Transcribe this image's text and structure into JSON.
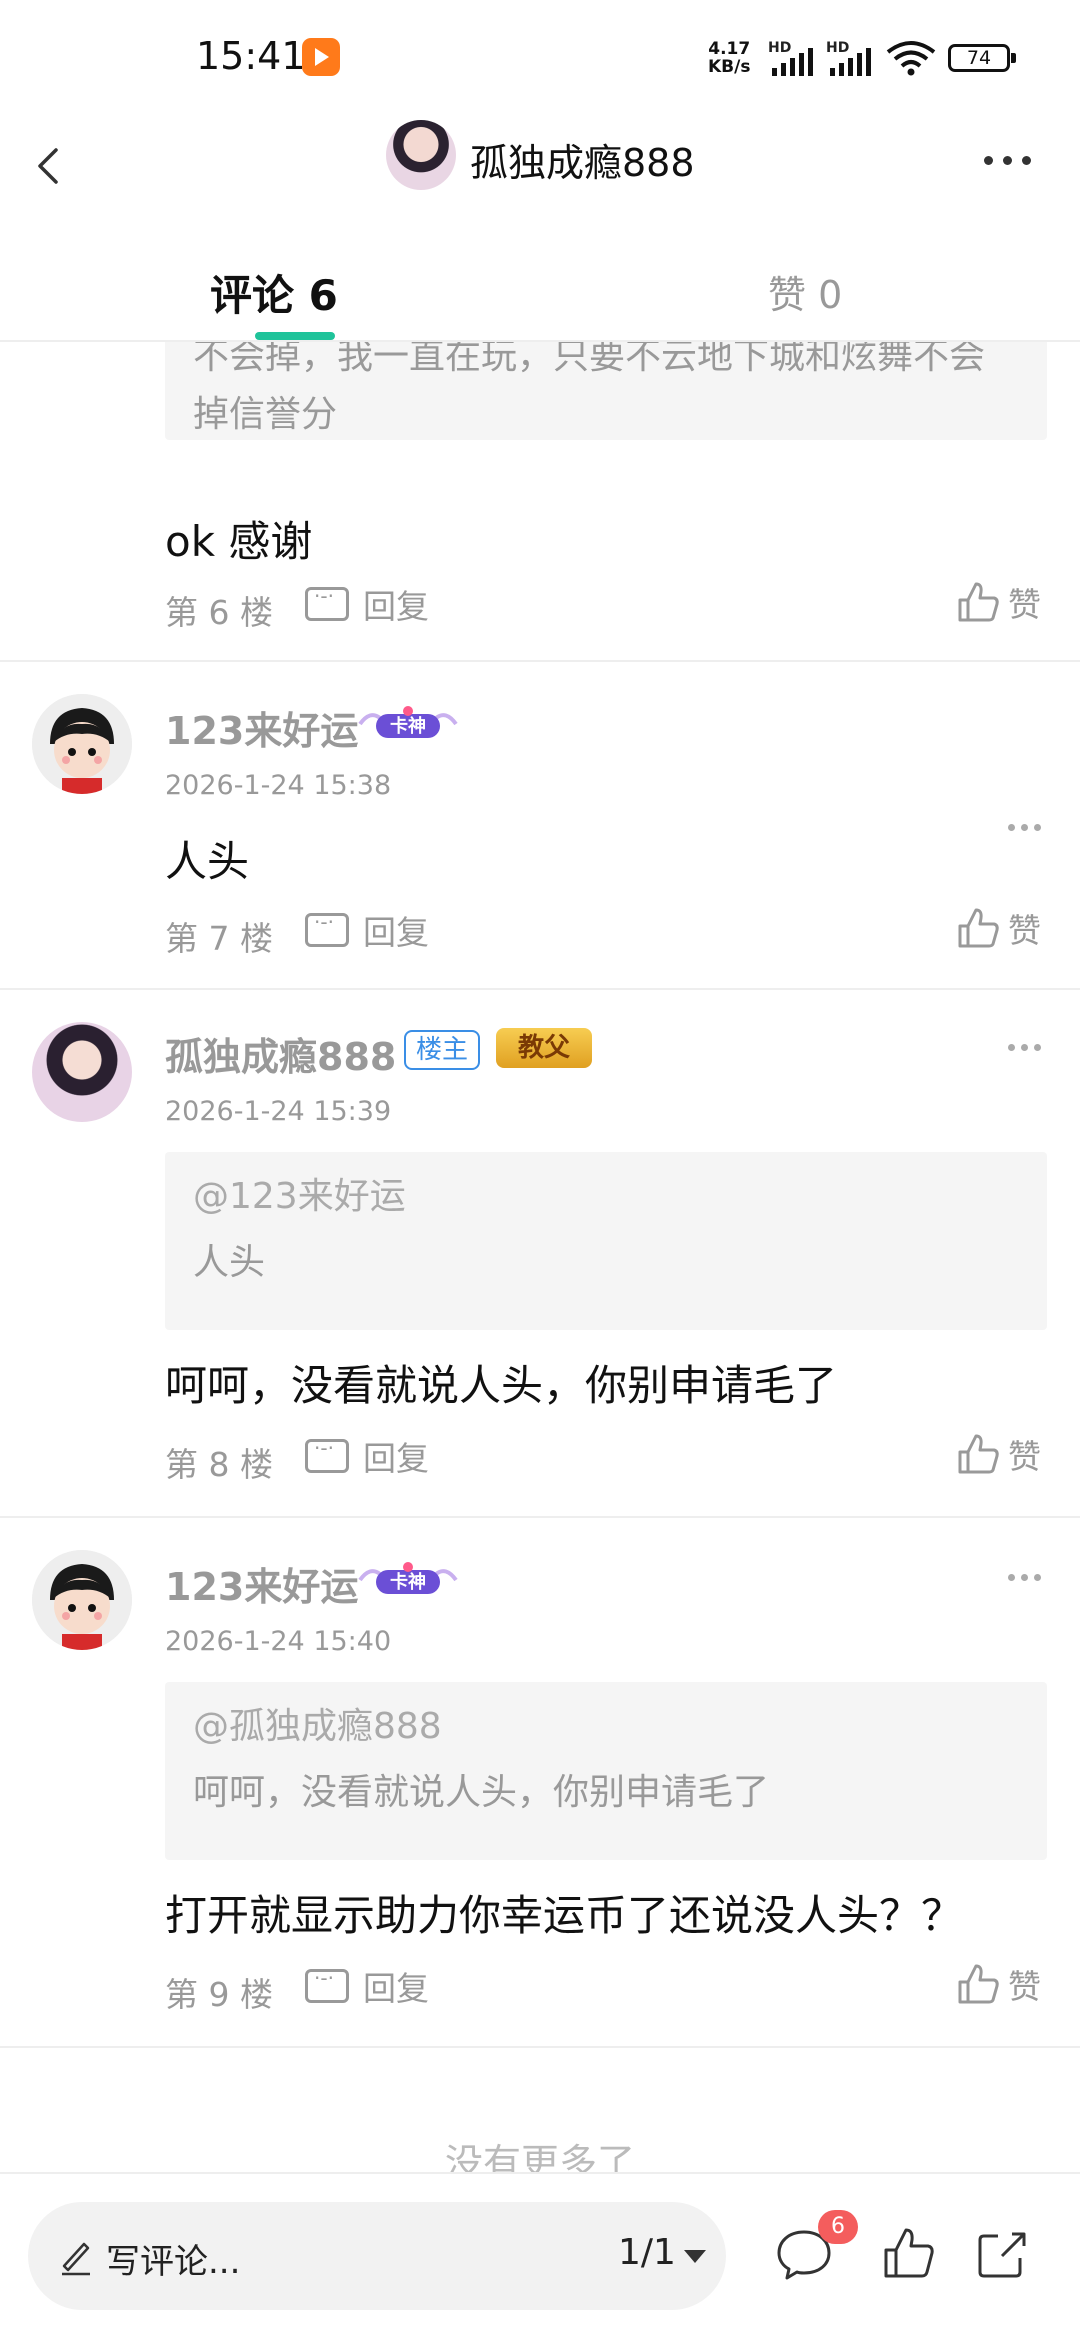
{
  "status_bar": {
    "time": "15:41",
    "network_speed_value": "4.17",
    "network_speed_unit": "KB/s",
    "signal_1_label": "HD",
    "signal_2_label": "HD",
    "battery": "74"
  },
  "header": {
    "title": "孤独成瘾888"
  },
  "tabs": {
    "comments_label": "评论",
    "comments_count": "6",
    "likes_label": "赞",
    "likes_count": "0"
  },
  "comments": [
    {
      "quote_text": "不会掉，我一直在玩，只要不云地下城和炫舞不会掉信誉分",
      "body": "ok 感谢",
      "floor": "第 6 楼",
      "reply_label": "回复",
      "like_label": "赞"
    },
    {
      "username": "123来好运",
      "badge": "卡神",
      "timestamp": "2026-1-24 15:38",
      "body": "人头",
      "floor": "第 7 楼",
      "reply_label": "回复",
      "like_label": "赞"
    },
    {
      "username": "孤独成瘾888",
      "owner_badge": "楼主",
      "badge": "教父",
      "timestamp": "2026-1-24 15:39",
      "quote_author": "@123来好运",
      "quote_text": "人头",
      "body": "呵呵，没看就说人头，你别申请毛了",
      "floor": "第 8 楼",
      "reply_label": "回复",
      "like_label": "赞"
    },
    {
      "username": "123来好运",
      "badge": "卡神",
      "timestamp": "2026-1-24 15:40",
      "quote_author": "@孤独成瘾888",
      "quote_text": "呵呵，没看就说人头，你别申请毛了",
      "body": "打开就显示助力你幸运币了还说没人头？？",
      "floor": "第 9 楼",
      "reply_label": "回复",
      "like_label": "赞"
    }
  ],
  "footer": {
    "no_more": "没有更多了"
  },
  "bottom_bar": {
    "comment_placeholder": "写评论...",
    "page_indicator": "1/1",
    "comment_badge_count": "6"
  },
  "colors": {
    "accent": "#1fc39a",
    "owner_badge": "#3a8ee6",
    "notification": "#f45d5d"
  }
}
